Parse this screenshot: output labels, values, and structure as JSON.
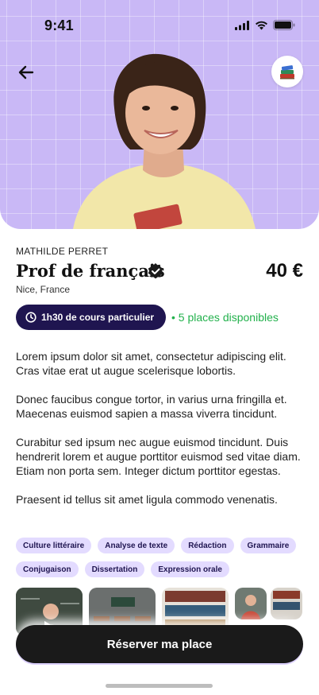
{
  "status_bar": {
    "time": "9:41"
  },
  "header": {
    "back_icon": "arrow-left-icon",
    "badge_icon": "books-icon"
  },
  "teacher": {
    "name": "MATHILDE PERRET",
    "title": "Prof de français",
    "verified_icon": "verified-check-icon",
    "location": "Nice, France"
  },
  "price": "40 €",
  "session": {
    "duration_label": "1h30 de cours particulier",
    "clock_icon": "clock-icon",
    "availability": "• 5 places disponibles",
    "availability_color": "#22b14c",
    "pill_color": "#1f1550"
  },
  "description": [
    "Lorem ipsum dolor sit amet, consectetur adipiscing elit. Cras vitae erat ut augue scelerisque lobortis.",
    "Donec faucibus congue tortor, in varius urna fringilla et. Maecenas euismod sapien a massa viverra tincidunt.",
    "Curabitur sed ipsum nec augue euismod tincidunt. Duis hendrerit lorem et augue porttitor euismod sed vitae diam. Etiam non porta sem. Integer dictum porttitor egestas.",
    "Praesent id tellus sit amet ligula commodo venenatis."
  ],
  "tags": [
    "Culture littéraire",
    "Analyse de texte",
    "Rédaction",
    "Grammaire",
    "Conjugaison",
    "Dissertation",
    "Expression orale"
  ],
  "cta": {
    "label": "Réserver ma place"
  },
  "colors": {
    "hero_bg": "#c9b8f6",
    "tag_bg": "#e3dbff",
    "cta_bg": "#1a1a1a"
  }
}
